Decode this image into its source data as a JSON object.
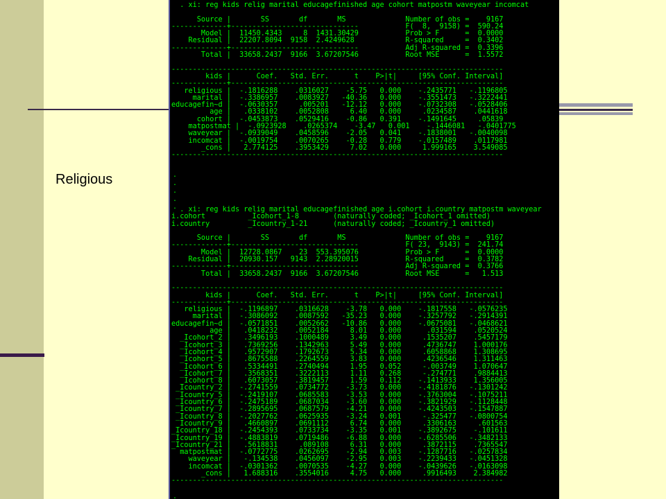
{
  "slide": {
    "side_label": "Religious"
  },
  "console": {
    "regression_1": "  . xi: reg kids relig marital educagefinished age cohort matpostm waveyear incomcat\n\n      Source |       SS       df       MS              Number of obs =    9167\n-------------+------------------------------           F(  8,  9158) =  590.24\n       Model |  11450.4343     8  1431.30429           Prob > F      =  0.0000\n    Residual |  22207.8094  9158  2.4249628            R-squared     =  0.3402\n-------------+------------------------------           Adj R-squared =  0.3396\n       Total |  33658.2437  9166  3.67207546           Root MSE      =  1.5572\n\n------------------------------------------------------------------------------\n        kids |      Coef.   Std. Err.      t    P>|t|     [95% Conf. Interval]\n-------------+----------------------------------------------------------------\n   religious |  -.1816288    .0316027    -5.75   0.000    -.2435771   -.1196805\n     marital |  -.3386957    .0083927   -40.36   0.000    -.3551473   -.3222441\neducagefin~d |  -.0630357     .005201   -12.12   0.000    -.0732308   -.0528406\n         age |   .0338102    .0052808     6.40   0.000     .0234587    .0441618\n      cohort |  -.0453873    .0529416    -0.86   0.391    -.1491645     .05839\n    matpostmat |  -.0923928    .0265374    -3.47   0.001    -.1446081   -.0401775\n    waveyear |  -.0939049    .0458596    -2.05   0.041    -.1838001   -.0040098\n    incomcat |  -.0019754    .0070265    -0.28   0.779    -.0157489    .0117981\n       _cons |   2.774125    .3953429     7.02   0.000     1.999165    3.549085\n------------------------------------------------------------------------------",
    "prompt_mid": ".\n.\n.\n.\n.",
    "regression_2": "  . xi: reg kids relig marital educagefinished age i.cohort i.country matpostm waveyear\ni.cohort          _Icohort_1-8        (naturally coded; _Icohort_1 omitted)\ni.country         _Icountry_1-21      (naturally coded; _Icountry_1 omitted)\n\n      Source |       SS       df       MS              Number of obs =    9167\n-------------+------------------------------           F( 23,  9143) =  241.74\n       Model |  12728.0867    23  553.395076           Prob > F      =  0.0000\n    Residual |  20930.157   9143  2.28920015           R-squared     =  0.3782\n-------------+------------------------------           Adj R-squared =  0.3766\n       Total |  33658.2437  9166  3.67207546           Root MSE      =   1.513\n\n------------------------------------------------------------------------------\n        kids |      Coef.   Std. Err.      t    P>|t|     [95% Conf. Interval]\n-------------+----------------------------------------------------------------\n   religious |  -.1196897    .0316628    -3.78   0.000    -.1817558   -.0576235\n     marital |  -.3086092    .0087592   -35.23   0.000    -.3257792   -.2914391\neducagefin~d |  -.0571851    .0052662   -10.86   0.000    -.0675081   -.0468621\n         age |   .0418232    .0052184     8.01   0.000      .031594    .0520524\n  _Icohort_2 |   .3496193    .1000489     3.49   0.000     .1535207    .5457179\n  _Icohort_3 |   .7369256    .1342963     5.49   0.000     .4736747    1.000176\n  _Icohort_4 |   .9572907    .1792673     5.34   0.000     .6058868    1.308695\n  _Icohort_5 |   .8675588    .2264559     3.83   0.000     .4236546    1.311463\n  _Icohort_6 |   .5334491    .2740494     1.95   0.052     -.003749    1.070647\n  _Icohort_7 |   .3568351    .3222113     1.11   0.268     -.274771    .9884413\n  _Icohort_8 |   .6073057    .3819457     1.59   0.112    -.1413933    1.356005\n _Icountry_2 |  -.2741559    .0734772    -3.73   0.000    -.4181876   -.1301242\n _Icountry_5 |  -.2419107    .0685583    -3.53   0.000    -.3763004   -.1075211\n _Icountry_6 |  -.2475189    .0687034    -3.60   0.000    -.3821929   -.1128448\n _Icountry_7 |  -.2895695    .0687579    -4.21   0.000    -.4243503   -.1547887\n _Icountry_8 |  -.2027762    .0625935    -3.24   0.001     -.325477   -.0800754\n _Icountry_9 |   .4660897    .0691112     6.74   0.000     .3306163     .601563\n_Icountry_18 |  -.2454393    .0733734    -3.35   0.001    -.3892675    -.101611\n_Icountry_19 |  -.4883819    .0719486    -6.88   0.000    -.6285506   -.3482133\n_Icountry_21 |   .5618831     .089108     6.31   0.000     .3872115    .7365547\n  matpostmat |  -.0772775    .0262695    -2.94   0.003    -.1287716   -.0257834\n    waveyear |   -.134538    .0456097    -2.95   0.003    -.2239433   -.0451328\n    incomcat |  -.0301362    .0070535    -4.27   0.000    -.0439626   -.0163098\n       _cons |   1.688316    .3554016     4.75   0.000     .9916493    2.384982\n------------------------------------------------------------------------------",
    "prompt_end": "."
  },
  "colors": {
    "slide_background": "#ffffcc",
    "sidebar": "#cccc99",
    "accent_dark": "#3a1a4a",
    "accent_gray": "#9999aa",
    "console_background": "#000000",
    "console_text": "#00ff00"
  }
}
